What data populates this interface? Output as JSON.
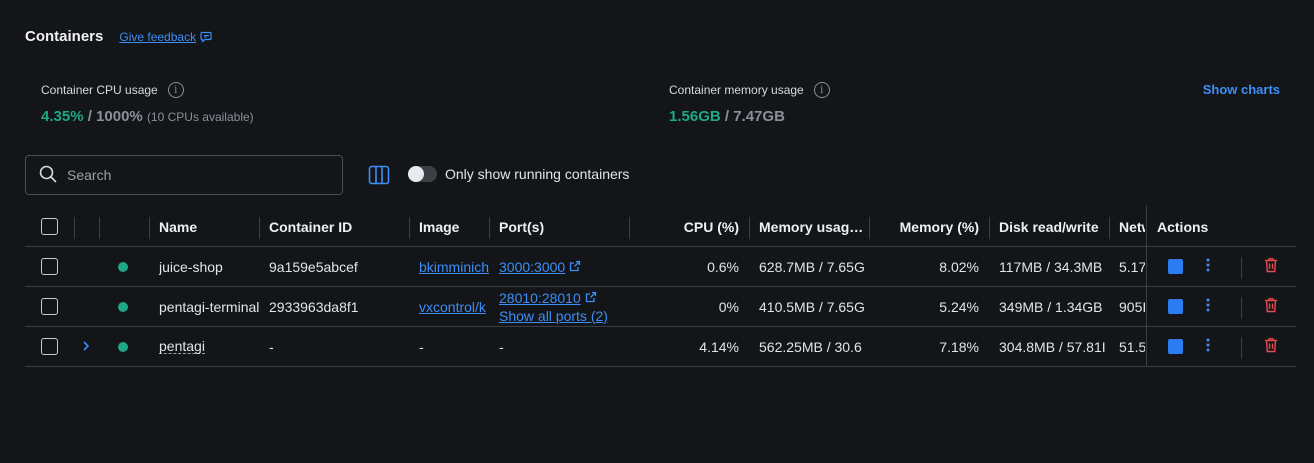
{
  "header": {
    "title": "Containers",
    "feedback_label": "Give feedback"
  },
  "stats": {
    "cpu": {
      "label": "Container CPU usage",
      "value": "4.35%",
      "total": "/ 1000%",
      "note": "(10 CPUs available)"
    },
    "memory": {
      "label": "Container memory usage",
      "value": "1.56GB",
      "total": "/ 7.47GB"
    },
    "show_charts_label": "Show charts"
  },
  "toolbar": {
    "search_placeholder": "Search",
    "toggle_label": "Only show running containers",
    "toggle_on": false
  },
  "table": {
    "columns": [
      "Name",
      "Container ID",
      "Image",
      "Port(s)",
      "CPU (%)",
      "Memory usag…",
      "Memory (%)",
      "Disk read/write",
      "Netw",
      "Actions"
    ],
    "rows": [
      {
        "name": "juice-shop",
        "id": "9a159e5abcef",
        "image": "bkimminich",
        "port": "3000:3000",
        "port_extra": "",
        "cpu": "0.6%",
        "mem_usage": "628.7MB / 7.65G",
        "mem_pct": "8.02%",
        "disk": "117MB / 34.3MB",
        "net": "5.17",
        "status": "running",
        "expandable": false
      },
      {
        "name": "pentagi-terminal",
        "id": "2933963da8f1",
        "image": "vxcontrol/k",
        "port": "28010:28010",
        "port_extra": "Show all ports (2)",
        "cpu": "0%",
        "mem_usage": "410.5MB / 7.65G",
        "mem_pct": "5.24%",
        "disk": "349MB / 1.34GB",
        "net": "905I",
        "status": "running",
        "expandable": false
      },
      {
        "name": "pentagi",
        "id": "-",
        "image": "-",
        "port": "-",
        "port_extra": "",
        "cpu": "4.14%",
        "mem_usage": "562.25MB / 30.6",
        "mem_pct": "7.18%",
        "disk": "304.8MB / 57.81I",
        "net": "51.5",
        "status": "running",
        "expandable": true
      }
    ]
  },
  "colors": {
    "background": "#131519",
    "accent_blue": "#3d8ef5",
    "running_green": "#1ea883",
    "delete_red": "#e5484d"
  },
  "icons": [
    "feedback-icon",
    "info-icon",
    "search-icon",
    "columns-icon",
    "external-link-icon",
    "stop-icon",
    "more-vertical-icon",
    "trash-icon",
    "chevron-right-icon"
  ]
}
